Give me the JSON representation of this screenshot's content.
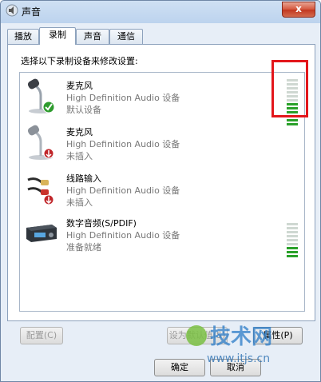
{
  "window": {
    "title": "声音",
    "close_label": "x"
  },
  "tabs": [
    {
      "label": "播放",
      "active": false
    },
    {
      "label": "录制",
      "active": true
    },
    {
      "label": "声音",
      "active": false
    },
    {
      "label": "通信",
      "active": false
    }
  ],
  "instruction": "选择以下录制设备来修改设置:",
  "devices": [
    {
      "name": "麦克风",
      "description": "High Definition Audio 设备",
      "status": "默认设备",
      "icon": "microphone-default-icon",
      "level_bars_on": 6,
      "level_bars_total": 12
    },
    {
      "name": "麦克风",
      "description": "High Definition Audio 设备",
      "status": "未插入",
      "icon": "microphone-unplugged-icon"
    },
    {
      "name": "线路输入",
      "description": "High Definition Audio 设备",
      "status": "未插入",
      "icon": "line-in-unplugged-icon"
    },
    {
      "name": "数字音频(S/PDIF)",
      "description": "High Definition Audio 设备",
      "status": "准备就绪",
      "icon": "spdif-device-icon",
      "level_bars_on": 3,
      "level_bars_total": 9
    }
  ],
  "buttons": {
    "configure": "配置(C)",
    "set_default": "设为默认值(S)",
    "properties": "属性(P)",
    "ok": "确定",
    "cancel": "取消"
  },
  "watermark": {
    "text": "技术网",
    "url": "www.itjs.cn"
  },
  "colors": {
    "highlight": "#e3161b",
    "level_on": "#2aa12a"
  }
}
